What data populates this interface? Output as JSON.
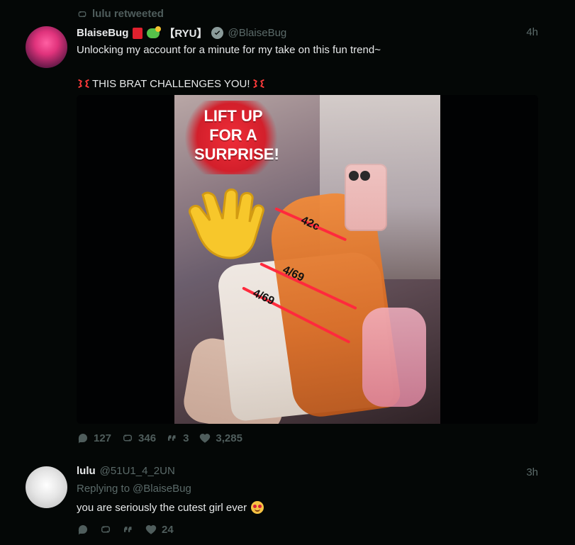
{
  "retweet": {
    "label": "lulu retweeted",
    "icon": "retweet-icon"
  },
  "tweet": {
    "author": {
      "name": "BlaiseBug",
      "tag": "【RYU】",
      "handle": "@BlaiseBug",
      "verified": true,
      "avatar": "avatar"
    },
    "time": "4h",
    "text": "Unlocking my account for a minute for my take on this fun trend~",
    "challenge": "THIS BRAT CHALLENGES YOU!",
    "image": {
      "overlay_text": "LIFT UP FOR A SURPRISE!",
      "labels": [
        "42c",
        "4/69",
        "4/69"
      ]
    },
    "stats": {
      "replies": "127",
      "retweets": "346",
      "quotes": "3",
      "likes": "3,285"
    }
  },
  "reply": {
    "author": {
      "name": "lulu",
      "handle": "@51U1_4_2UN"
    },
    "time": "3h",
    "replying_to_prefix": "Replying to",
    "replying_to": "@BlaiseBug",
    "text": "you are seriously the cutest girl ever",
    "stats": {
      "likes": "24"
    }
  },
  "colors": {
    "background": "#040706",
    "muted": "#5b6a69",
    "text": "#e7e9ea",
    "accent_red": "#e0212e"
  }
}
